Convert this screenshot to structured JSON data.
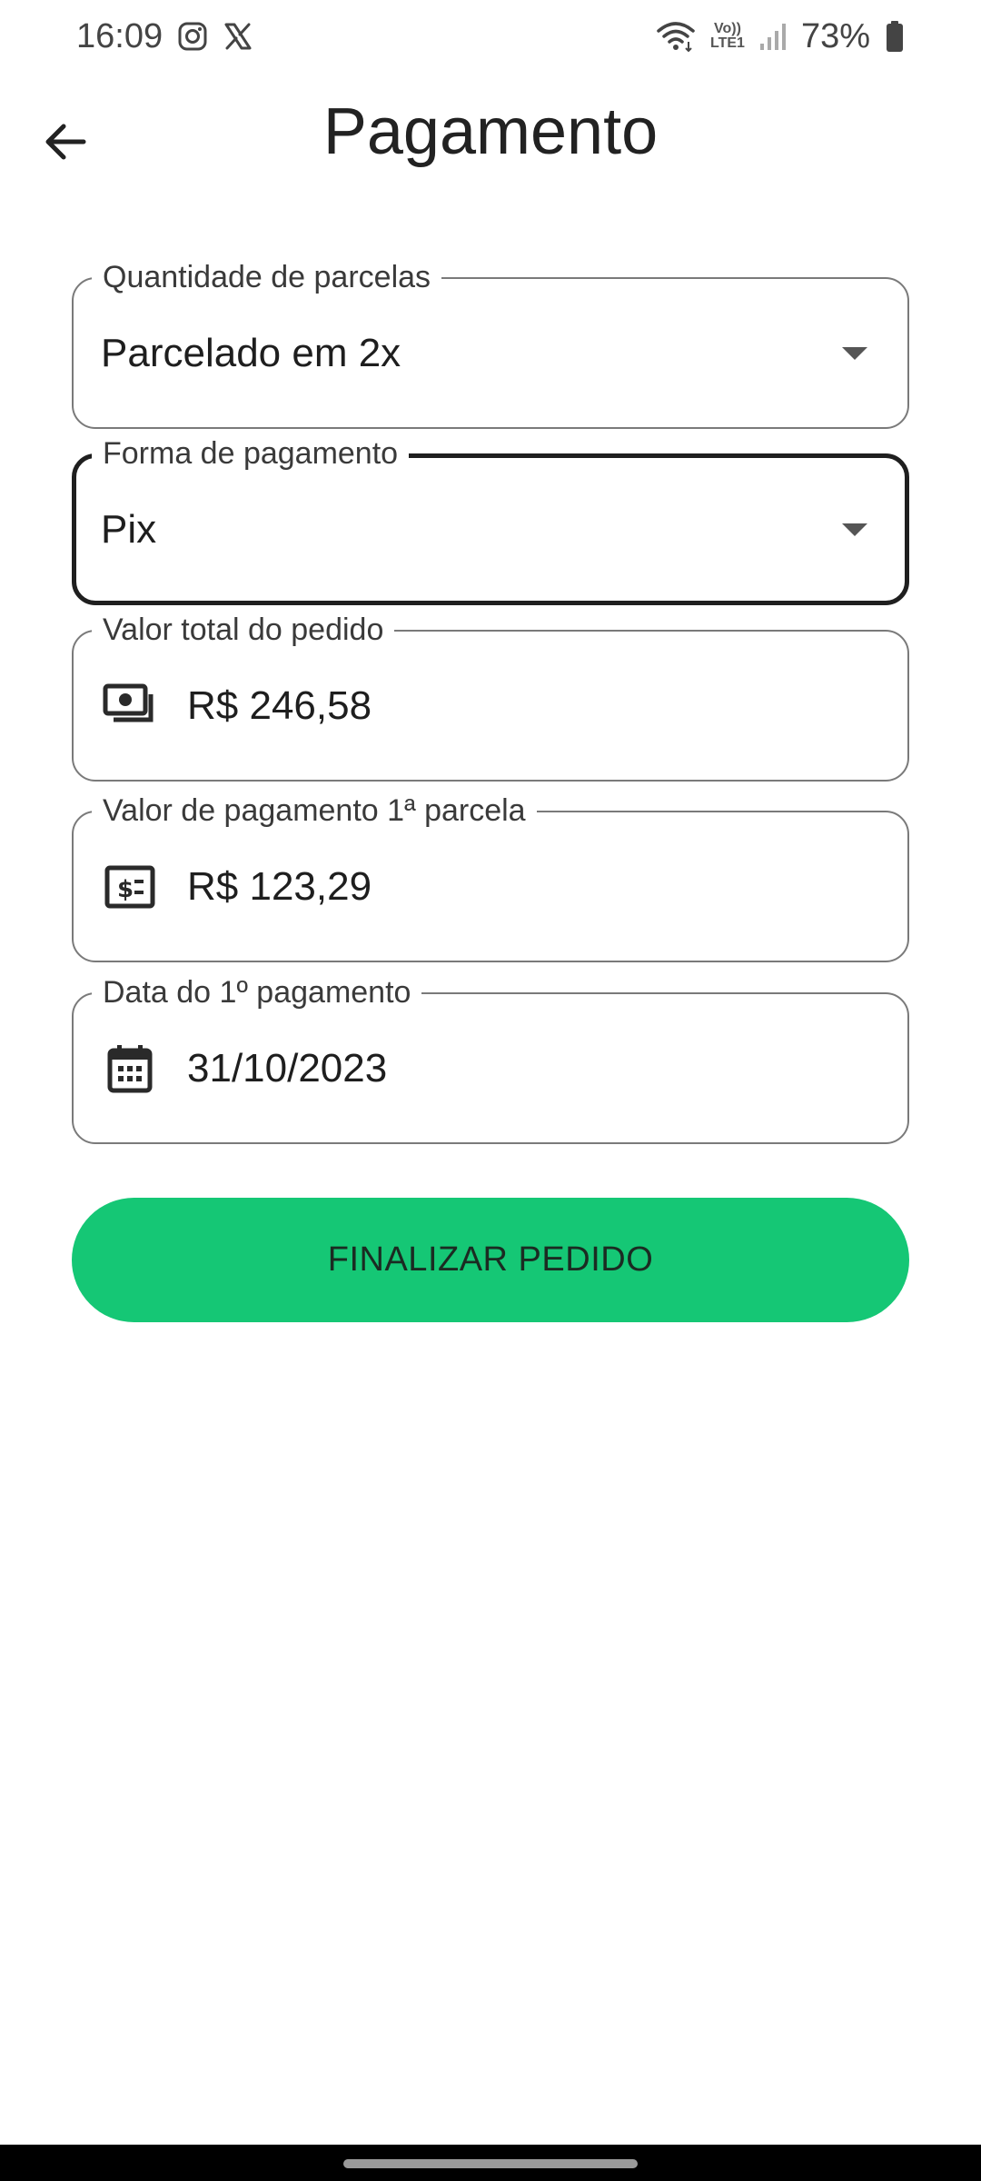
{
  "status_bar": {
    "time": "16:09",
    "notification_icons": [
      "instagram-icon",
      "x-icon"
    ],
    "signal_text_top": "Vo))",
    "signal_text_bottom": "LTE1",
    "battery_percent": "73%"
  },
  "header": {
    "title": "Pagamento",
    "back_icon": "arrow-left-icon"
  },
  "form": {
    "installments": {
      "label": "Quantidade de parcelas",
      "value": "Parcelado em 2x"
    },
    "payment_method": {
      "label": "Forma de pagamento",
      "value": "Pix"
    },
    "order_total": {
      "label": "Valor total do pedido",
      "value": "R$ 246,58",
      "icon": "money-icon"
    },
    "first_installment_value": {
      "label": "Valor de pagamento 1ª parcela",
      "value": "R$ 123,29",
      "icon": "bill-icon"
    },
    "first_payment_date": {
      "label": "Data do 1º pagamento",
      "value": "31/10/2023",
      "icon": "calendar-icon"
    }
  },
  "actions": {
    "finish_label": "FINALIZAR PEDIDO"
  },
  "colors": {
    "primary_button": "#15c775",
    "focused_border": "#1f1f1f",
    "field_border": "#7a7a7a"
  }
}
